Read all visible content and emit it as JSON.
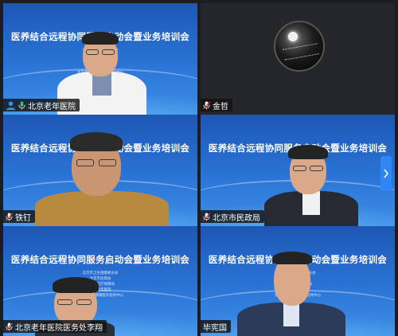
{
  "meeting": {
    "slide_title": "医养结合远程协同服务启动会暨业务培训会",
    "org_lines_small": [
      "北京市卫生健康委员会",
      "北京市民政局",
      "北京市医疗保障局",
      "北京老年医院",
      "北京市老年健康服务指导中心"
    ]
  },
  "participants": [
    {
      "name": "北京老年医院",
      "icons": [
        "user-icon",
        "mic-icon"
      ]
    },
    {
      "name": "金哲",
      "icons": [
        "mic-icon"
      ]
    },
    {
      "name": "铁钉",
      "icons": [
        "mic-icon"
      ]
    },
    {
      "name": "北京市民政局",
      "icons": [
        "mic-icon"
      ]
    },
    {
      "name": "北京老年医院医务处李翔",
      "icons": [
        "mic-icon"
      ]
    },
    {
      "name": "毕宪国",
      "icons": []
    }
  ],
  "colors": {
    "slide_blue": "#2a74d6",
    "label_bg": "#141414",
    "accent_tab": "#2f86f6",
    "mic_muted": "#e04a3c",
    "user_blue": "#3d8fe6"
  }
}
